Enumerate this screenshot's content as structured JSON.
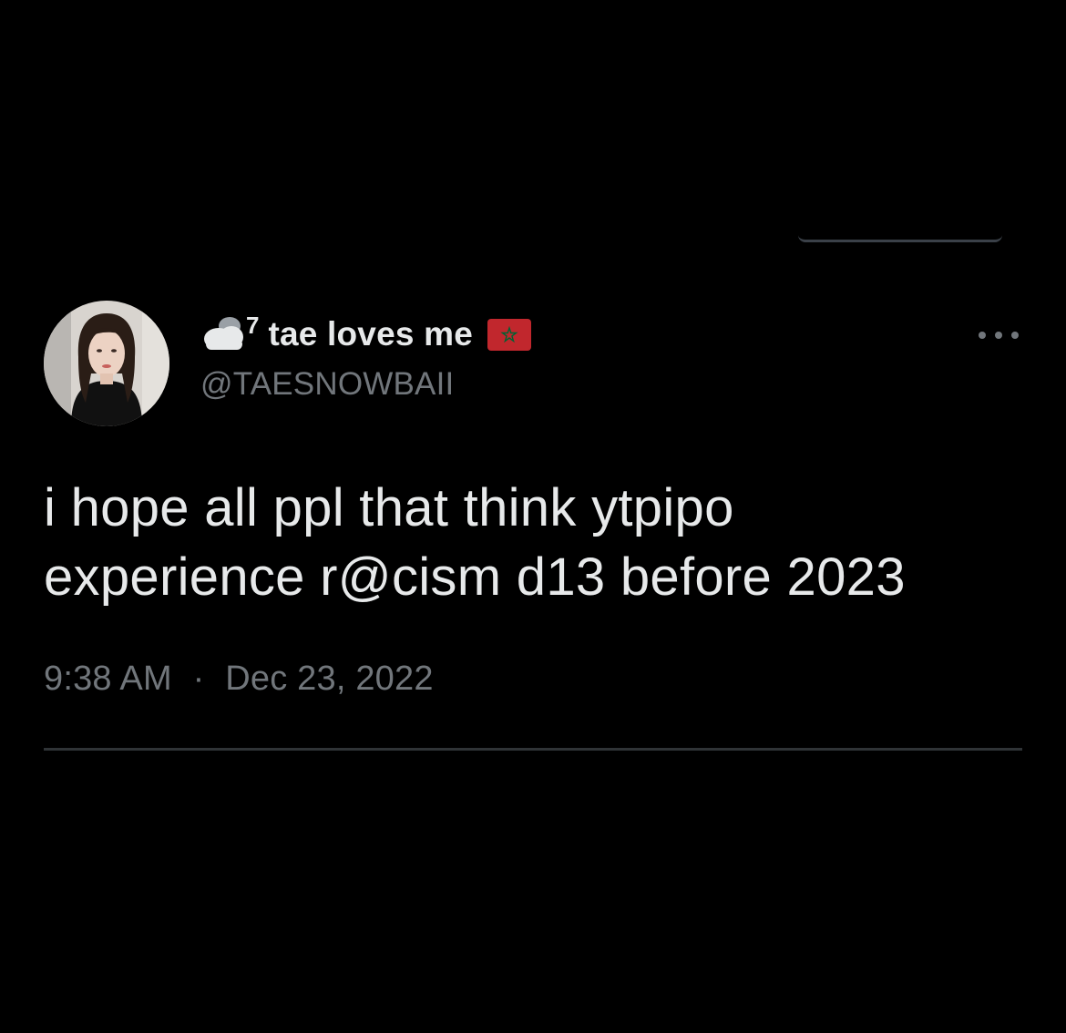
{
  "tweet": {
    "author": {
      "display_name": "tae loves me",
      "superscript": "7",
      "handle": "@TAESNOWBAII",
      "name_icons": [
        "cloud-icon",
        "morocco-flag-icon"
      ],
      "avatar": "profile-photo"
    },
    "text_line_1": "i hope all ppl that think ytpipo",
    "text_line_2": "experience r@cism d13 before 2023",
    "time": "9:38 AM",
    "separator": "·",
    "date": "Dec 23, 2022",
    "more_icon": "more-horizontal-icon"
  },
  "colors": {
    "background": "#000000",
    "primary_text": "#e7e9ea",
    "secondary_text": "#71767b",
    "divider": "#2f3336",
    "flag_red": "#c1272d",
    "flag_star": "#006233"
  }
}
